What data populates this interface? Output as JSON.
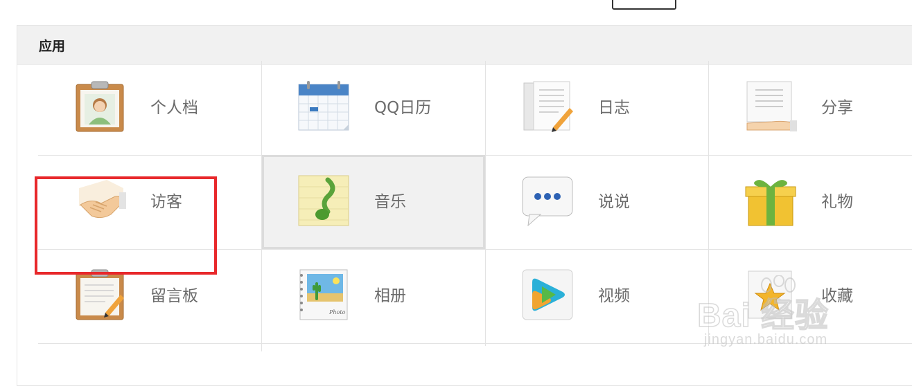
{
  "section": {
    "title": "应用"
  },
  "apps": [
    {
      "label": "个人档",
      "icon": "profile-clipboard-icon"
    },
    {
      "label": "QQ日历",
      "icon": "calendar-icon"
    },
    {
      "label": "日志",
      "icon": "blog-notebook-icon"
    },
    {
      "label": "分享",
      "icon": "share-hand-document-icon"
    },
    {
      "label": "访客",
      "icon": "visitor-handshake-icon"
    },
    {
      "label": "音乐",
      "icon": "music-note-icon"
    },
    {
      "label": "说说",
      "icon": "speech-bubble-icon"
    },
    {
      "label": "礼物",
      "icon": "gift-box-icon"
    },
    {
      "label": "留言板",
      "icon": "message-board-clipboard-icon"
    },
    {
      "label": "相册",
      "icon": "photo-album-icon"
    },
    {
      "label": "视频",
      "icon": "video-play-icon"
    },
    {
      "label": "收藏",
      "icon": "favorites-star-icon"
    }
  ],
  "active_app": "音乐",
  "highlighted_app": "访客",
  "watermark": {
    "text": "Bai 经验",
    "url_text": "jingyan.baidu.com"
  },
  "colors": {
    "highlight": "#e8282b",
    "header_bg": "#f1f1f1",
    "label": "#6b6b6b"
  }
}
